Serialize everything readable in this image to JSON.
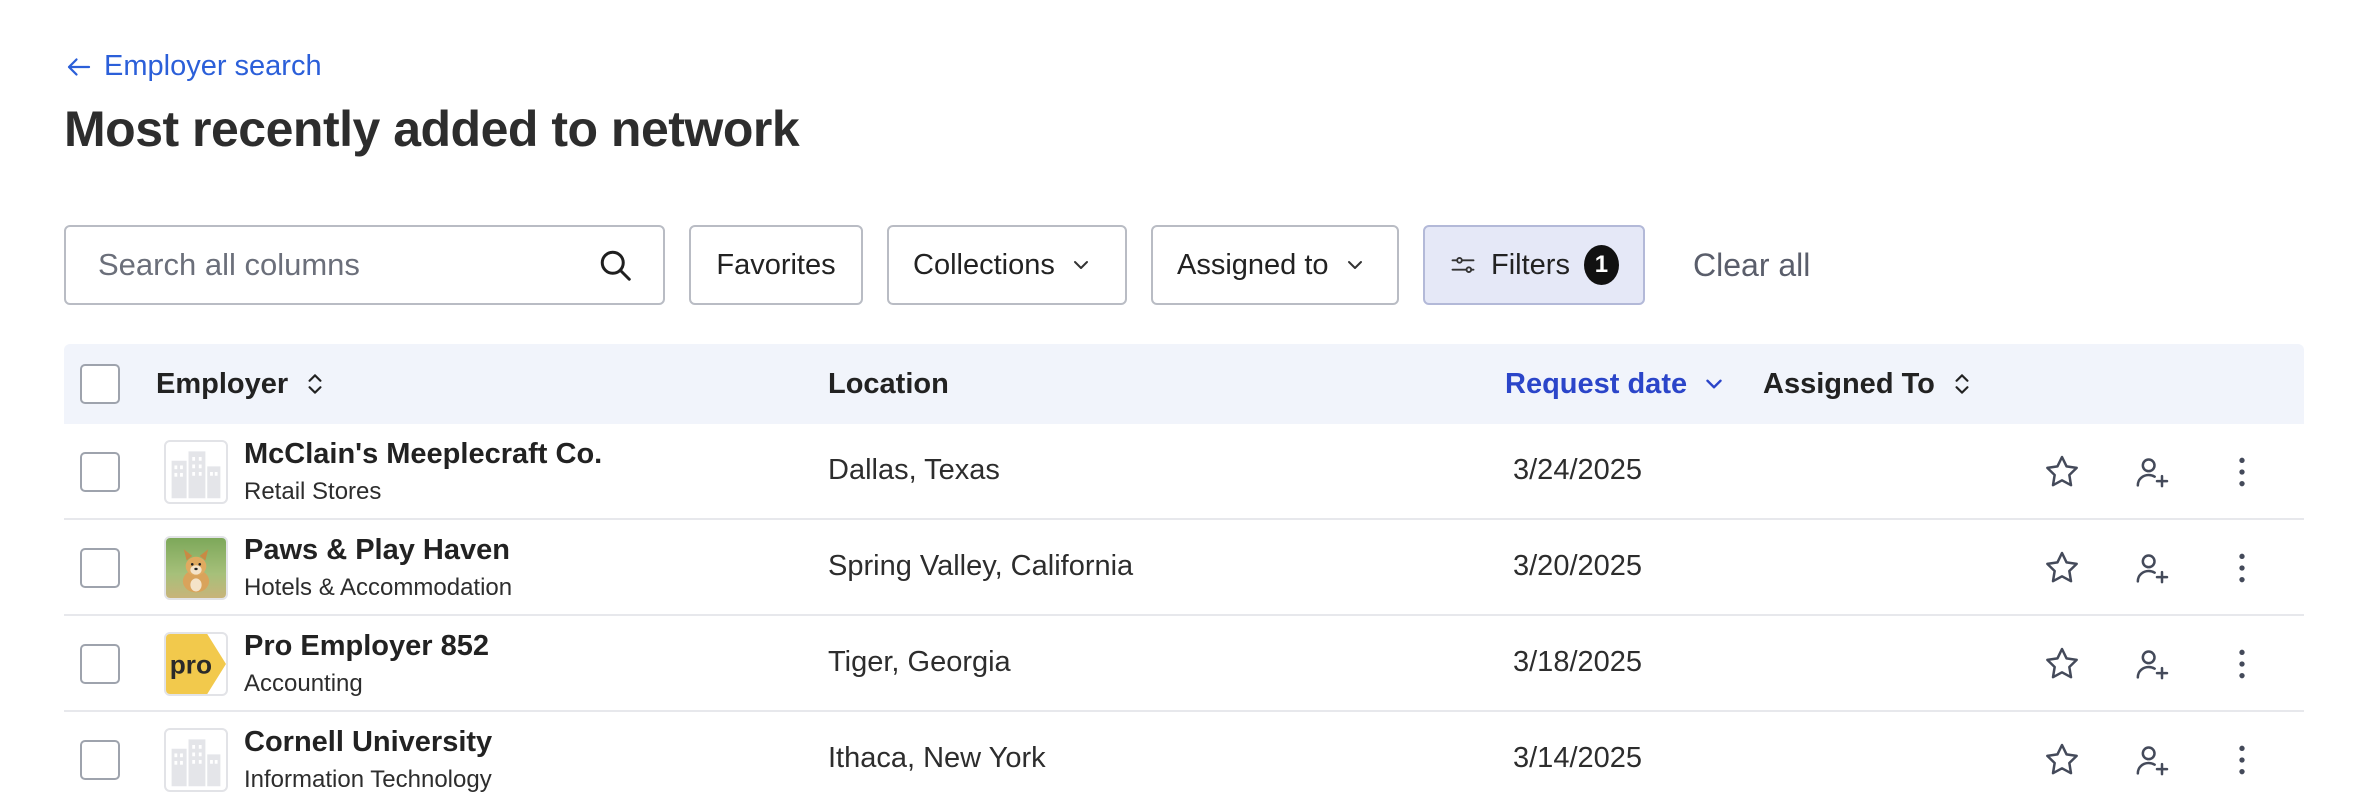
{
  "nav": {
    "back_label": "Employer search"
  },
  "page": {
    "title": "Most recently added to network"
  },
  "toolbar": {
    "search_placeholder": "Search all columns",
    "favorites_label": "Favorites",
    "collections_label": "Collections",
    "assigned_to_label": "Assigned to",
    "filters_label": "Filters",
    "filters_count": "1",
    "clear_all_label": "Clear all"
  },
  "table": {
    "columns": {
      "employer": "Employer",
      "location": "Location",
      "request_date": "Request date",
      "assigned_to": "Assigned To"
    },
    "rows": [
      {
        "name": "McClain's Meeplecraft Co.",
        "industry": "Retail Stores",
        "location": "Dallas, Texas",
        "date": "3/24/2025",
        "logo": "building-placeholder"
      },
      {
        "name": "Paws & Play Haven",
        "industry": "Hotels & Accommodation",
        "location": "Spring Valley, California",
        "date": "3/20/2025",
        "logo": "puppy-photo"
      },
      {
        "name": "Pro Employer 852",
        "industry": "Accounting",
        "location": "Tiger, Georgia",
        "date": "3/18/2025",
        "logo": "pro-badge",
        "logo_text": "pro"
      },
      {
        "name": "Cornell University",
        "industry": "Information Technology",
        "location": "Ithaca, New York",
        "date": "3/14/2025",
        "logo": "building-placeholder"
      }
    ]
  },
  "colors": {
    "link": "#2b5fd9",
    "active_sort": "#2b45c9",
    "header_bg": "#f1f4fb",
    "filters_bg": "#e5e8f7",
    "pro_logo": "#f2c94c"
  }
}
